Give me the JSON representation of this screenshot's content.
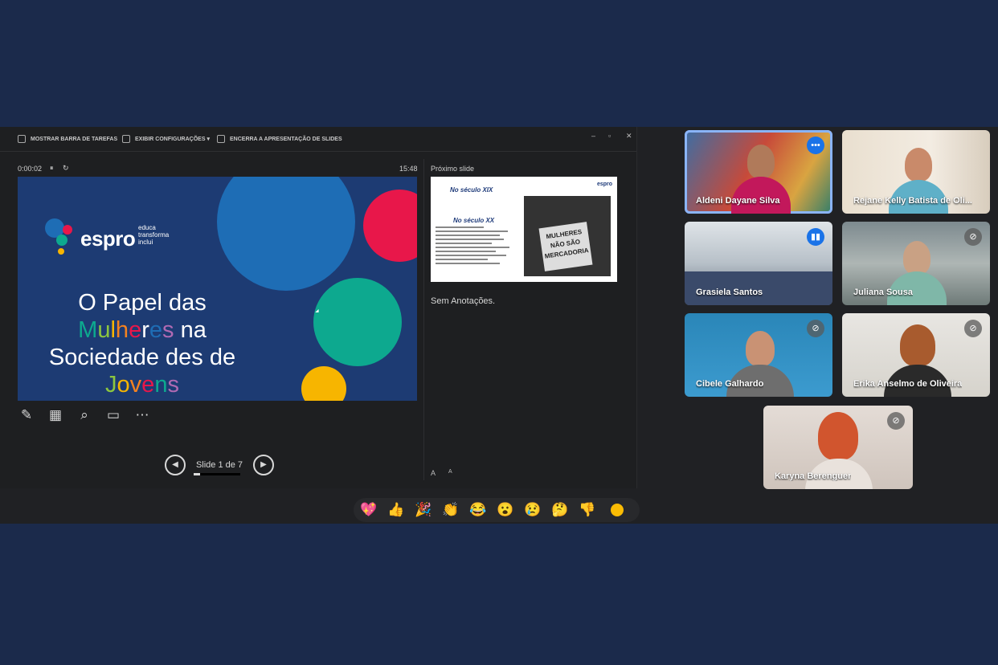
{
  "presenter": {
    "toolbar": {
      "taskbar": "MOSTRAR BARRA DE TAREFAS",
      "settings": "EXIBIR CONFIGURAÇÕES ▾",
      "end": "ENCERRA A APRESENTAÇÃO DE SLIDES"
    },
    "window_controls": [
      "–",
      "▫",
      "✕"
    ],
    "timer": "0:00:02",
    "clock": "15:48",
    "slide": {
      "logo_text": "espro",
      "logo_tagline": [
        "educa",
        "transforma",
        "inclui"
      ],
      "title_lines": [
        "O Papel das",
        "Mulheres na",
        "Sociedade des de",
        "Jovens"
      ],
      "colors": {
        "background": "#1d3b73",
        "blue": "#1e6db5",
        "red": "#e8174a",
        "teal": "#0da98f",
        "yellow": "#f7b500"
      }
    },
    "slide_counter": "Slide 1 de 7",
    "progress_fraction": 0.14,
    "next_slide_label": "Próximo slide",
    "next_slide": {
      "heading1": "No século XIX",
      "heading2": "No século XX",
      "sign_text": "MULHERES NÃO SÃO MERCADORIA",
      "logo": "espro"
    },
    "notes": "Sem Anotações.",
    "font_controls": [
      "A",
      "A"
    ]
  },
  "participants": [
    {
      "name": "Aldeni Dayane Silva",
      "badge": "more"
    },
    {
      "name": "Rejane Kelly Batista de Oli...",
      "badge": ""
    },
    {
      "name": "Grasiela Santos",
      "badge": "speaking"
    },
    {
      "name": "Juliana Sousa",
      "badge": "muted"
    },
    {
      "name": "Cibele Galhardo",
      "badge": "muted"
    },
    {
      "name": "Erika Anselmo de Oliveira",
      "badge": "muted"
    },
    {
      "name": "Karyna Berenguer",
      "badge": "muted"
    }
  ],
  "reactions": [
    "💖",
    "👍",
    "🎉",
    "👏",
    "😂",
    "😮",
    "😢",
    "🤔",
    "👎"
  ]
}
